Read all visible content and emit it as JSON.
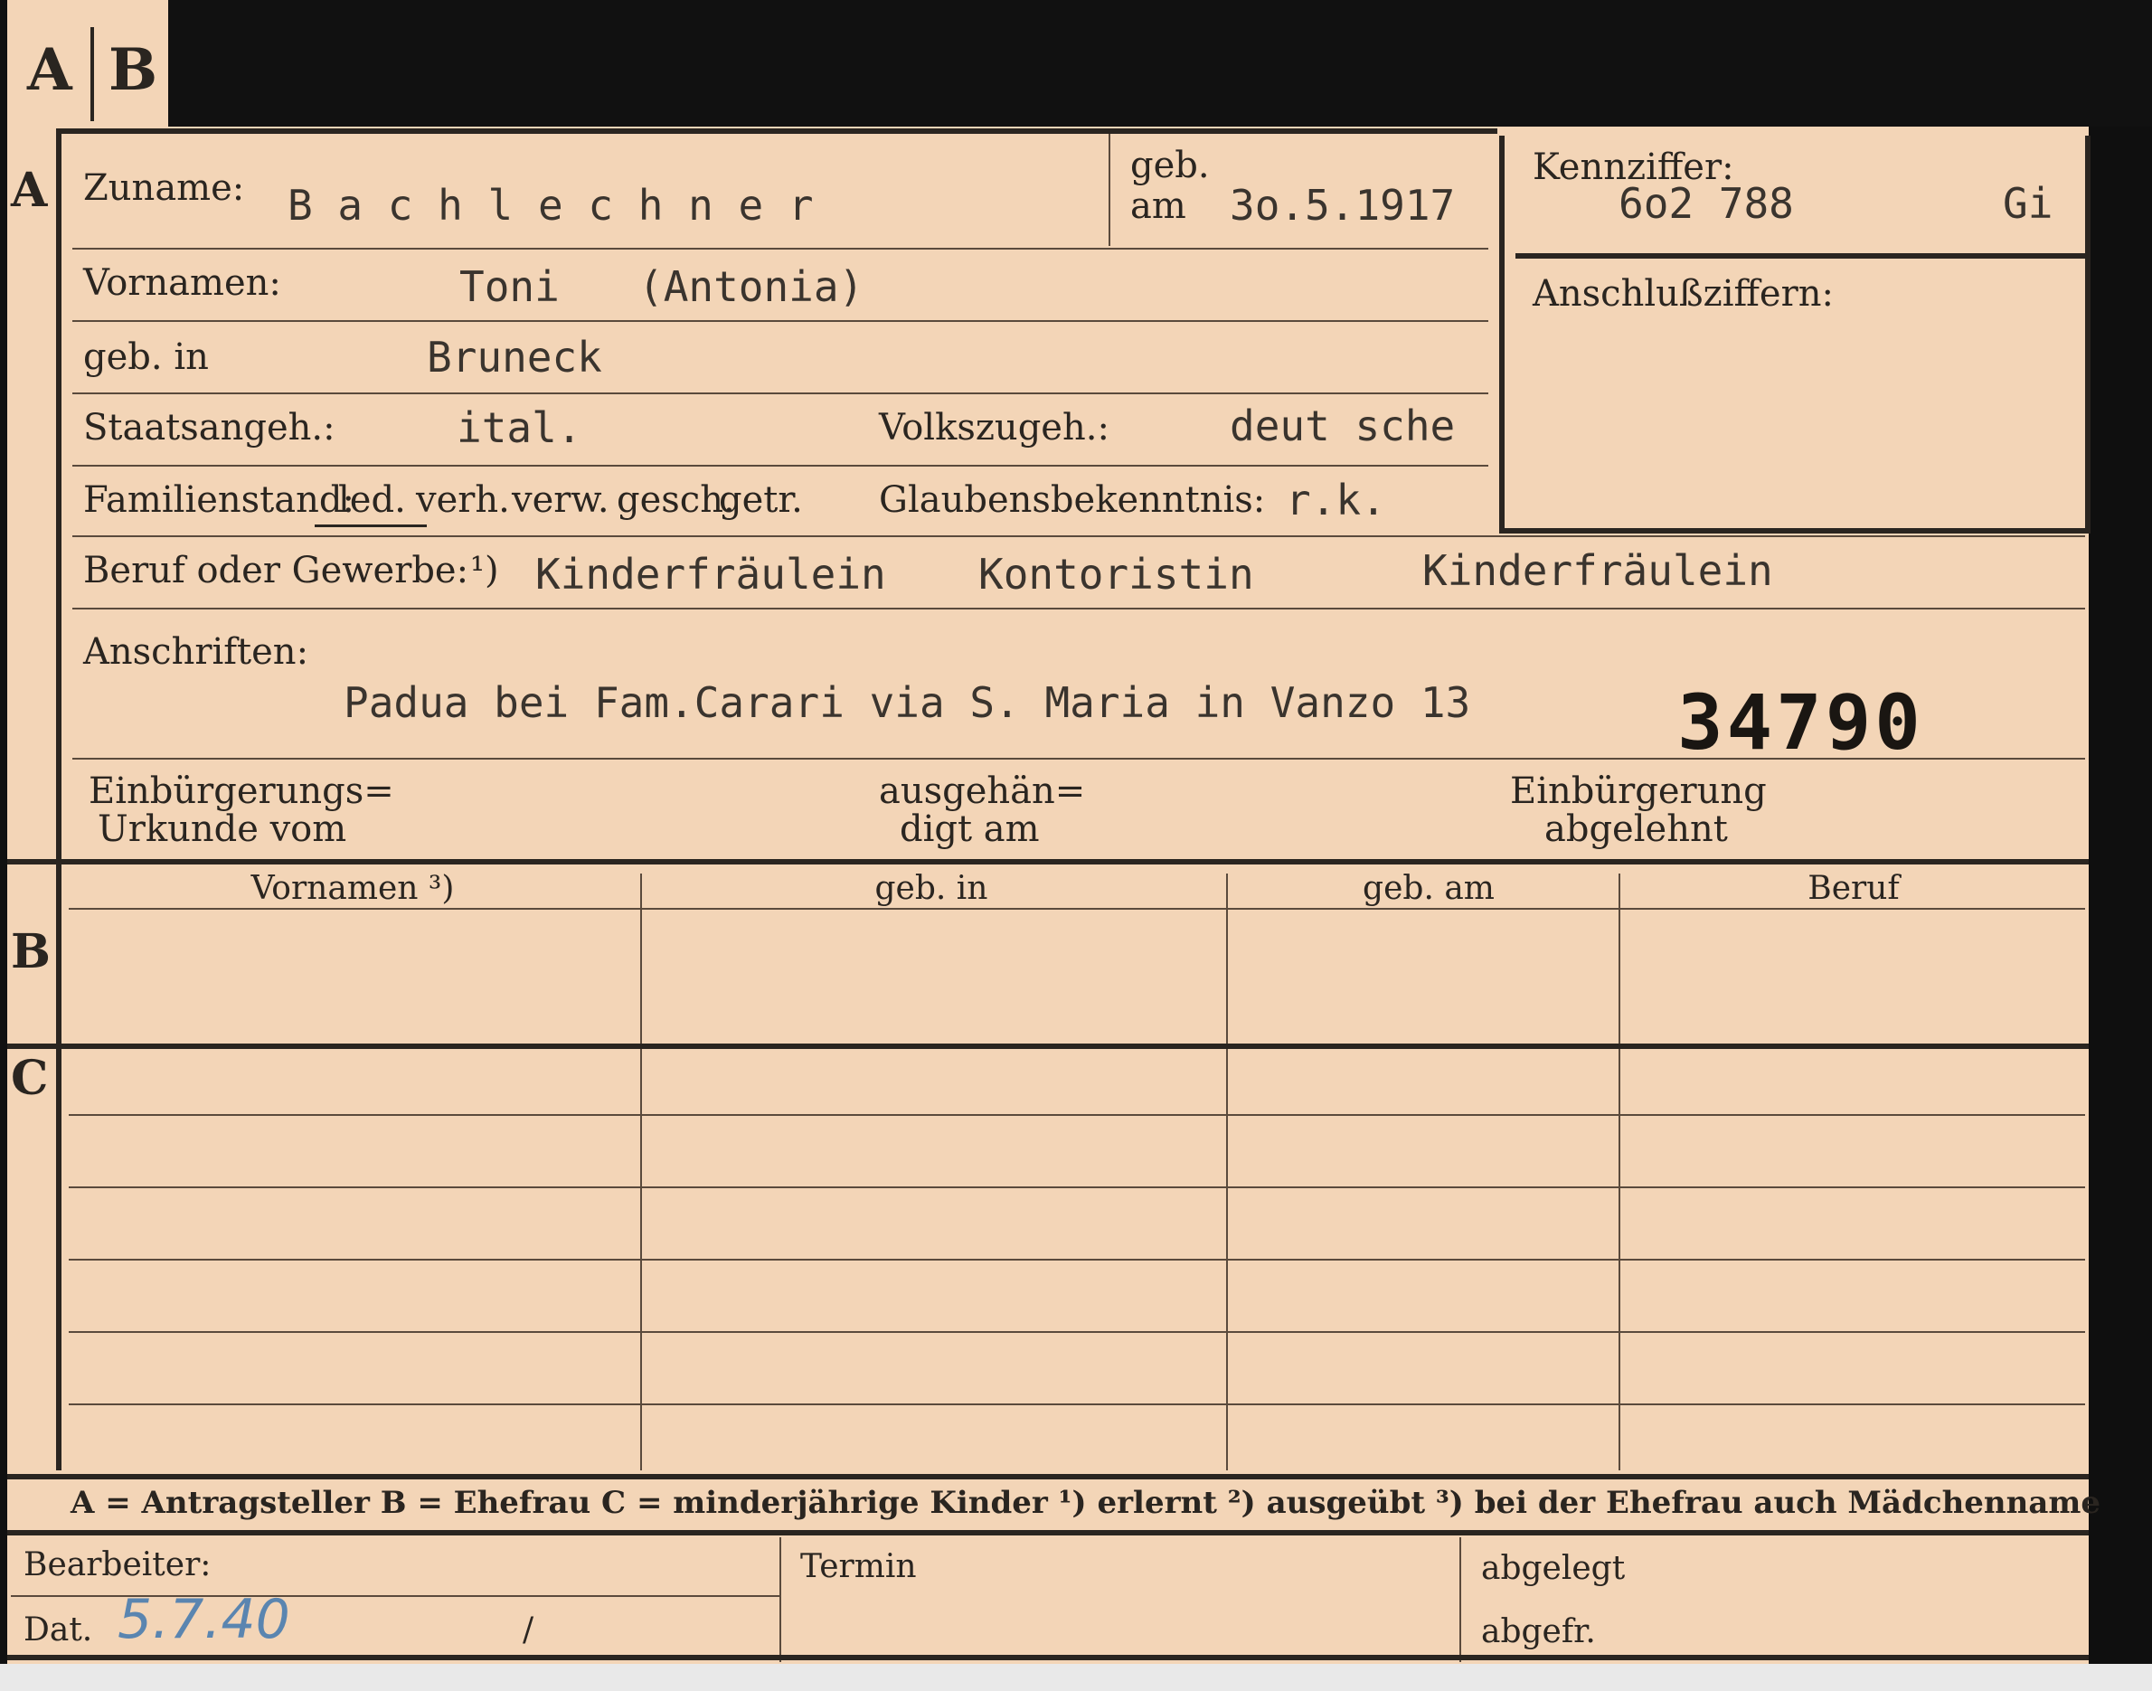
{
  "tabs": {
    "a": "A",
    "b": "B"
  },
  "sections": {
    "a": "A",
    "b": "B",
    "c": "C"
  },
  "labels": {
    "zuname": "Zuname:",
    "geb_am_1": "geb.",
    "geb_am_2": "am",
    "kennziffer": "Kennziffer:",
    "vornamen": "Vornamen:",
    "anschlussziffern": "Anschlußziffern:",
    "geb_in": "geb. in",
    "staatsangeh": "Staatsangeh.:",
    "volkszugeh": "Volkszugeh.:",
    "familienstand": "Familienstand:",
    "familienstand_opts": [
      "led.",
      "verh.",
      "verw.",
      "gesch.",
      "getr."
    ],
    "glaubensbekenntnis": "Glaubensbekenntnis:",
    "beruf": "Beruf oder Gewerbe:",
    "beruf_note": "¹)",
    "anschriften": "Anschriften:",
    "einbuergerung_1": "Einbürgerungs=",
    "einbuergerung_2": "Urkunde vom",
    "ausgehaendigt_1": "ausgehän=",
    "ausgehaendigt_2": "digt am",
    "einbuergerung_abgelehnt_1": "Einbürgerung",
    "einbuergerung_abgelehnt_2": "abgelehnt"
  },
  "values": {
    "zuname": "B a c h l e c h n e r",
    "geb_am": "3o.5.1917",
    "kennziffer_num": "6o2 788",
    "kennziffer_suffix": "Gi",
    "vornamen": "Toni",
    "vornamen_alt": "(Antonia)",
    "geb_in": "Bruneck",
    "staatsangeh": "ital.",
    "volkszugeh": "deut sche",
    "glaubensbekenntnis": "r.k.",
    "beruf_1": "Kinderfräulein",
    "beruf_2": "Kontoristin",
    "beruf_3": "Kinderfräulein",
    "anschrift": "Padua bei Fam.Carari via S. Maria in Vanzo 13",
    "stamp_number": "34790"
  },
  "table_headers": [
    "Vornamen ³)",
    "geb. in",
    "geb. am",
    "Beruf"
  ],
  "legend": "A = Antragsteller   B = Ehefrau   C = minderjährige Kinder   ¹) erlernt   ²) ausgeübt   ³) bei der Ehefrau auch Mädchenname",
  "footer": {
    "bearbeiter": "Bearbeiter:",
    "termin": "Termin",
    "abgelegt": "abgelegt",
    "dat": "Dat.",
    "dat_value": "5.7.40",
    "dat_slash": "/",
    "abgefr": "abgefr."
  },
  "colors": {
    "card": "#f3d5b7",
    "ink": "#2a2520",
    "typewriter": "#3a342e",
    "handwriting": "#5a85b0"
  }
}
